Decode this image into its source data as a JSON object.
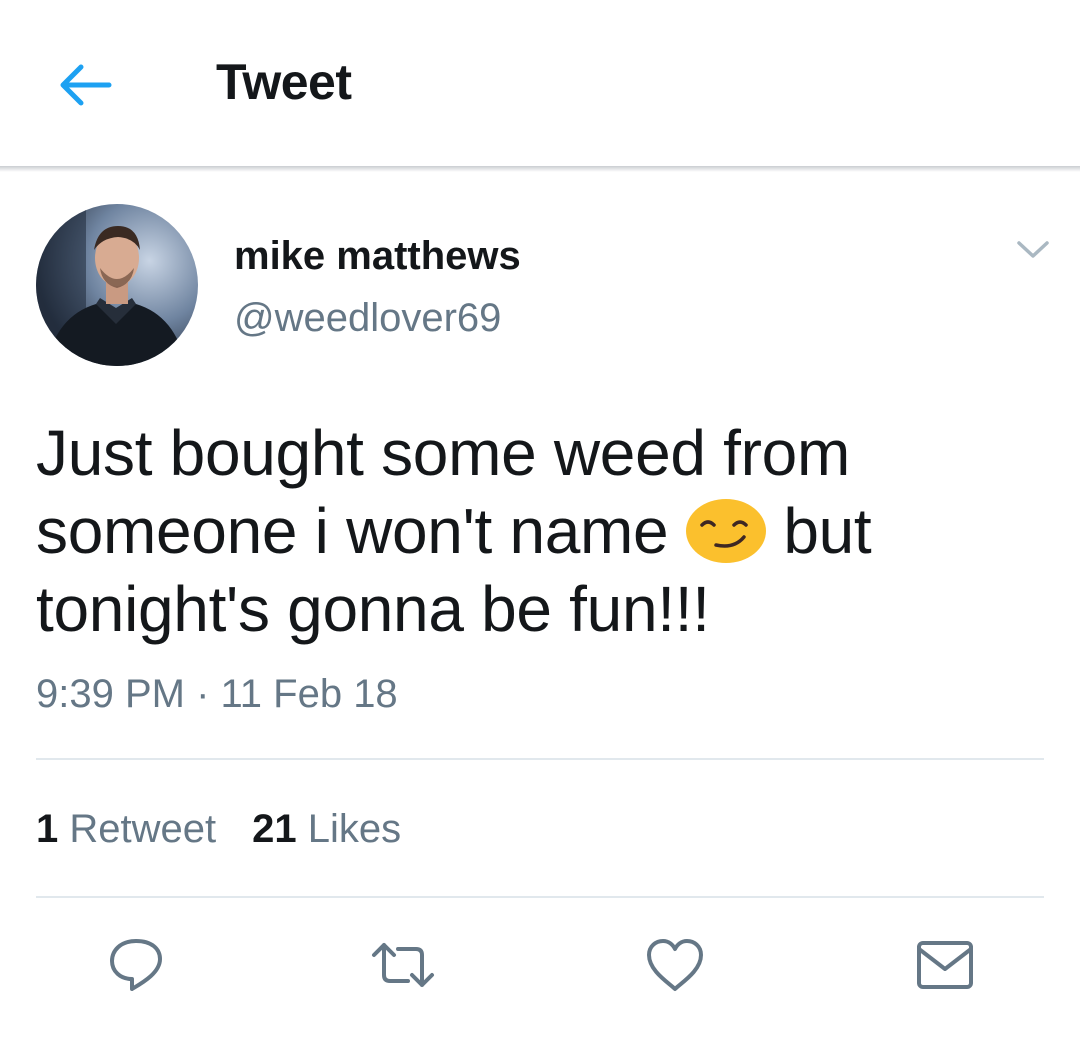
{
  "header": {
    "back_icon": "arrow-left-icon",
    "title": "Tweet",
    "accent_color": "#1da1f2"
  },
  "author": {
    "name": "mike matthews",
    "handle": "@weedlover69",
    "caret_icon": "chevron-down-icon"
  },
  "tweet": {
    "text_part1": "Just bought some weed from someone i won't name",
    "emoji": "smirking-face-emoji",
    "text_part2": "but tonight's gonna be fun!!!",
    "timestamp": "9:39 PM · 11 Feb 18"
  },
  "stats": {
    "retweets_count": "1",
    "retweets_label": "Retweet",
    "likes_count": "21",
    "likes_label": "Likes"
  },
  "actions": {
    "reply_icon": "reply-icon",
    "retweet_icon": "retweet-icon",
    "like_icon": "heart-icon",
    "share_icon": "envelope-icon",
    "icon_color": "#657786"
  }
}
